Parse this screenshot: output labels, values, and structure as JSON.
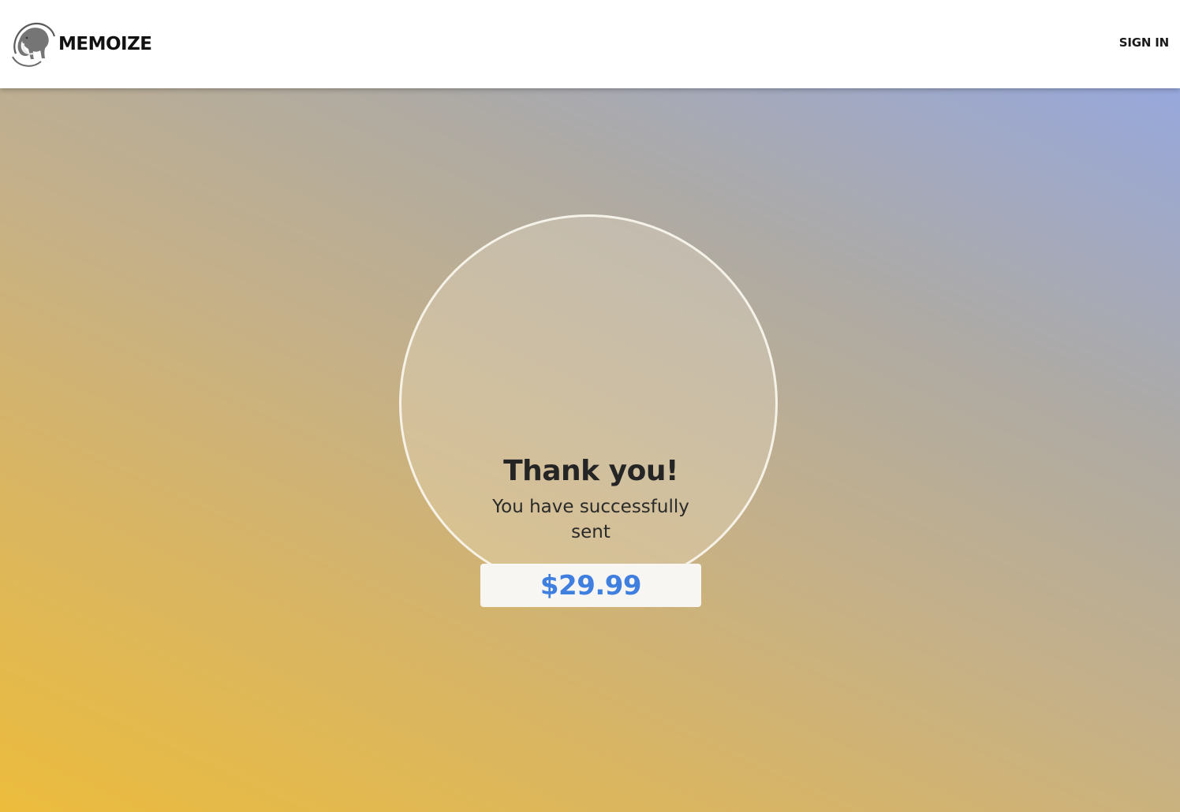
{
  "header": {
    "brand_name": "MEMOIZE",
    "logo_icon": "mammoth-logo-icon",
    "signin_label": "SIGN IN"
  },
  "confirmation": {
    "title": "Thank you!",
    "message": "You have successfully sent",
    "amount": "$29.99"
  },
  "colors": {
    "accent": "#3f7fe0",
    "gradient_start": "#ecbc3c",
    "gradient_end": "#97a8dc"
  }
}
